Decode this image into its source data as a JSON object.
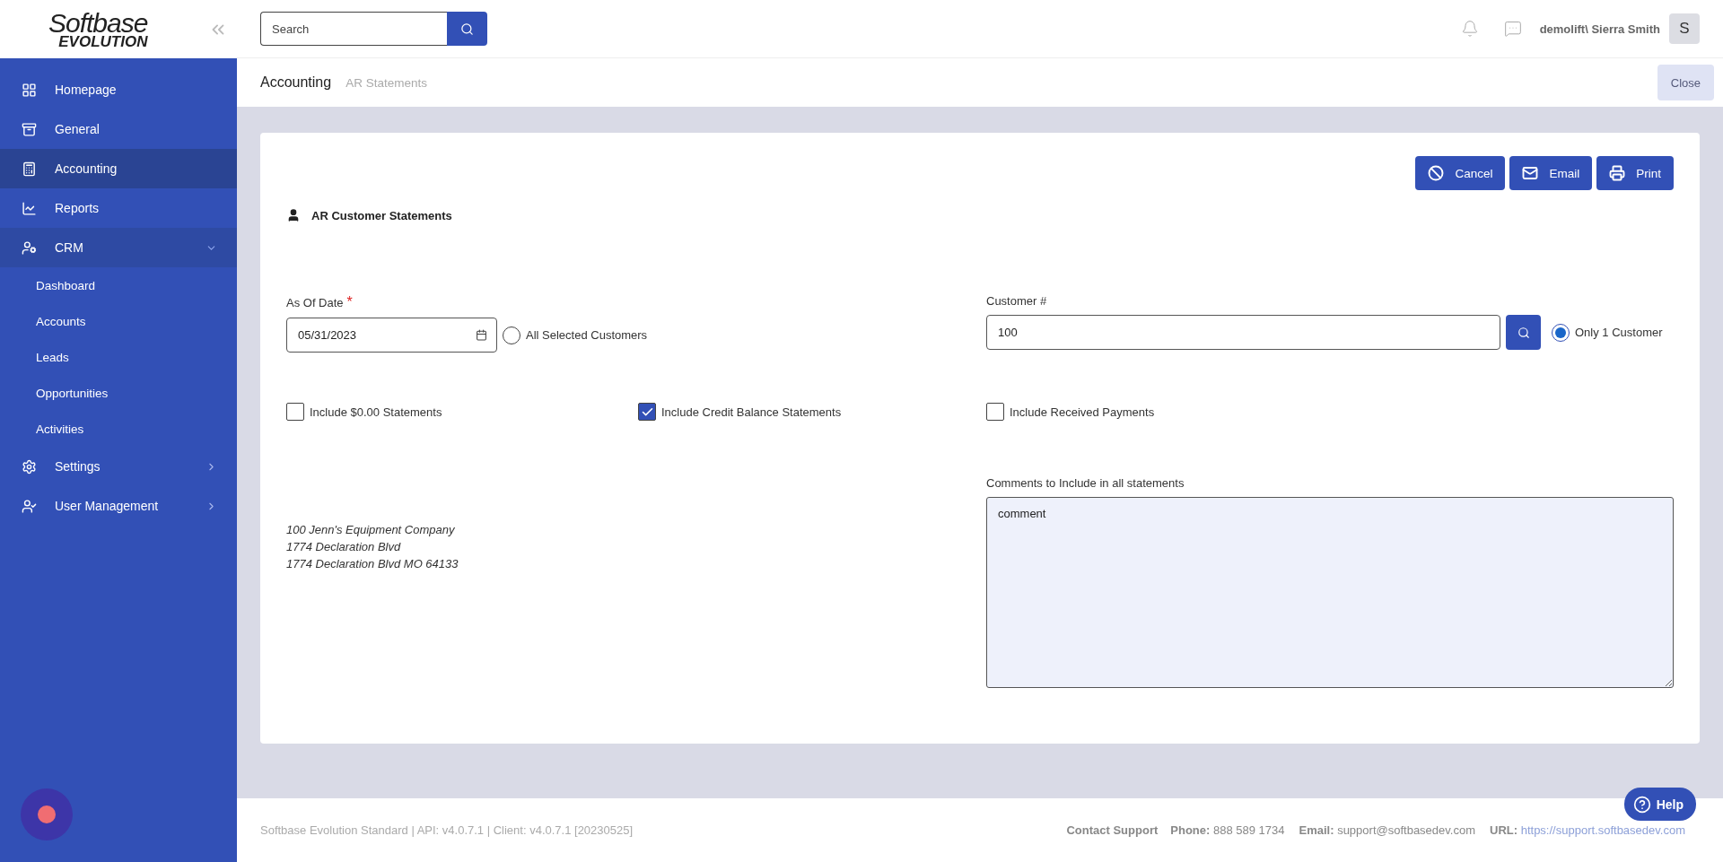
{
  "sidebar": {
    "logo": {
      "line1": "Softbase",
      "line2": "EVOLUTION"
    },
    "items": [
      {
        "label": "Homepage",
        "selected": false
      },
      {
        "label": "General",
        "selected": false
      },
      {
        "label": "Accounting",
        "selected": true
      },
      {
        "label": "Reports",
        "selected": false
      },
      {
        "label": "CRM",
        "selected": false,
        "expanded": true,
        "children": [
          {
            "label": "Dashboard",
            "selected": false
          },
          {
            "label": "Accounts",
            "selected": false
          },
          {
            "label": "Leads",
            "selected": false
          },
          {
            "label": "Opportunities",
            "selected": false
          },
          {
            "label": "Activities",
            "selected": false
          }
        ]
      },
      {
        "label": "Settings",
        "selected": false,
        "expanded": false
      },
      {
        "label": "User Management",
        "selected": false,
        "expanded": false
      }
    ]
  },
  "header": {
    "search": {
      "placeholder": "Search"
    },
    "user": "demolift\\ Sierra Smith",
    "avatar": "S"
  },
  "breadcrumb": {
    "items": [
      "Accounting",
      "AR Statements"
    ],
    "close": "Close"
  },
  "card": {
    "actions": [
      "Cancel",
      "Email",
      "Print"
    ],
    "title": "AR Customer Statements",
    "as_of_date": {
      "label": "As Of Date",
      "required_mark": "*",
      "value": "05/31/2023"
    },
    "radios": [
      {
        "label": "All Selected Customers",
        "selected": false
      },
      {
        "label": "Only 1 Customer",
        "selected": true
      }
    ],
    "customer": {
      "label": "Customer #",
      "value": "100"
    },
    "checkboxes": [
      {
        "label": "Include $0.00 Statements",
        "checked": false
      },
      {
        "label": "Include Credit Balance Statements",
        "checked": true
      },
      {
        "label": "Include Received Payments",
        "checked": false
      }
    ],
    "address": [
      "100 Jenn's Equipment Company",
      "1774 Declaration Blvd",
      "1774 Declaration Blvd MO 64133"
    ],
    "comments": {
      "label": "Comments to Include in all statements",
      "value": "comment"
    }
  },
  "footer": {
    "version": "Softbase Evolution Standard | API: v4.0.7.1 | Client: v4.0.7.1 [20230525]",
    "contact_title": "Contact Support",
    "contacts": [
      {
        "label": "Phone:",
        "value": "888 589 1734"
      },
      {
        "label": "Email:",
        "value": "support@softbasedev.com"
      },
      {
        "label": "URL:",
        "value": "https://support.softbasedev.com"
      }
    ]
  },
  "help": "Help"
}
